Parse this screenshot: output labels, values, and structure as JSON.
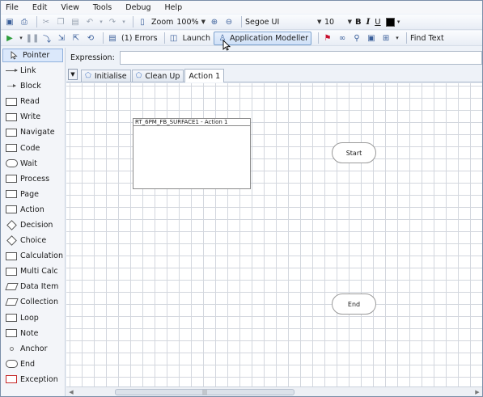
{
  "menu": [
    "File",
    "Edit",
    "View",
    "Tools",
    "Debug",
    "Help"
  ],
  "toolbar1": {
    "zoom_label": "Zoom",
    "zoom_value": "100%",
    "font_value": "Segoe UI",
    "size_value": "10",
    "bold": "B",
    "italic": "I",
    "underline": "U",
    "text_color": "#000000"
  },
  "toolbar2": {
    "errors_label": "(1) Errors",
    "launch_label": "Launch",
    "app_modeller_label": "Application Modeller",
    "find_text_label": "Find Text"
  },
  "palette": [
    {
      "label": "Pointer",
      "shape": "pointer"
    },
    {
      "label": "Link",
      "shape": "line"
    },
    {
      "label": "Block",
      "shape": "block"
    },
    {
      "label": "Read",
      "shape": "rect"
    },
    {
      "label": "Write",
      "shape": "rect"
    },
    {
      "label": "Navigate",
      "shape": "rect"
    },
    {
      "label": "Code",
      "shape": "rect"
    },
    {
      "label": "Wait",
      "shape": "round"
    },
    {
      "label": "Process",
      "shape": "rect"
    },
    {
      "label": "Page",
      "shape": "rect"
    },
    {
      "label": "Action",
      "shape": "rect"
    },
    {
      "label": "Decision",
      "shape": "diamond"
    },
    {
      "label": "Choice",
      "shape": "diamond"
    },
    {
      "label": "Calculation",
      "shape": "rect"
    },
    {
      "label": "Multi Calc",
      "shape": "rect"
    },
    {
      "label": "Data Item",
      "shape": "para"
    },
    {
      "label": "Collection",
      "shape": "para"
    },
    {
      "label": "Loop",
      "shape": "rect"
    },
    {
      "label": "Note",
      "shape": "rect"
    },
    {
      "label": "Anchor",
      "shape": "circle"
    },
    {
      "label": "End",
      "shape": "round"
    },
    {
      "label": "Exception",
      "shape": "red"
    }
  ],
  "expression": {
    "label": "Expression:",
    "value": ""
  },
  "tabs": [
    "Initialise",
    "Clean Up",
    "Action 1"
  ],
  "active_tab": "Action 1",
  "canvas": {
    "page_title": "RT_6PM_FB_SURFACE1 - Action 1",
    "start_label": "Start",
    "end_label": "End"
  },
  "scroll_thumb_grip": "|||"
}
